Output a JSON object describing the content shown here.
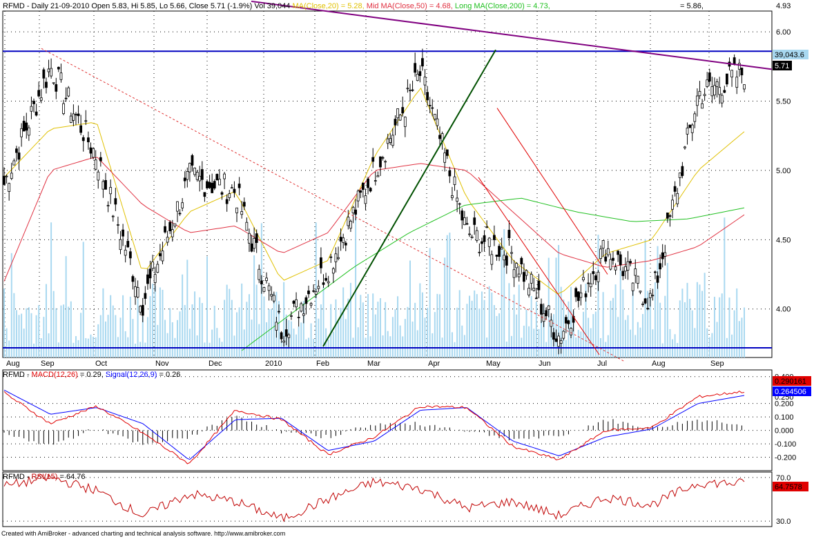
{
  "header": {
    "symbol_line": "RFMD - Daily 21-09-2010 Open 5.83, Hi 5.85, Lo 5.66, Close 5.71 (-1.9%) Vol 39,044",
    "ma20": "MA(Close,20) = 5.28,",
    "ma50": "Mid MA(Close,50) = 4.68,",
    "ma200": "Long MA(Close,200) = 4.73,",
    "extra": "= 5.86,",
    "top_right_value": "4.93"
  },
  "price_axis": {
    "ticks": [
      "6.00",
      "5.50",
      "5.00",
      "4.50",
      "4.00"
    ],
    "last_volume": "39,043.6",
    "last_close": "5.71"
  },
  "months": [
    "Aug",
    "Sep",
    "Oct",
    "Nov",
    "Dec",
    "2010",
    "Feb",
    "Mar",
    "Apr",
    "May",
    "Jun",
    "Jul",
    "Aug",
    "Sep"
  ],
  "macd": {
    "label_prefix": "RFMD - ",
    "macd_label": "MACD(12,26)",
    "macd_value": " = 0.29, ",
    "signal_label": "Signal(12,26,9)",
    "signal_value": " = 0.26",
    "ticks": [
      "0.400",
      "0.250",
      "0.200",
      "0.100",
      "0.000",
      "-0.100",
      "-0.200"
    ],
    "badge_macd": "0.290161",
    "badge_signal": "0.264506"
  },
  "rsi": {
    "label_prefix": "RFMD - ",
    "rsi_label": "RSI(15)",
    "rsi_value": " = 64.76",
    "ticks": [
      "70.0",
      "30.0"
    ],
    "badge": "64.7578"
  },
  "footer": "Created with AmiBroker - advanced charting and technical analysis software. http://www.amibroker.com",
  "footer_right": "—",
  "colors": {
    "ma20": "#e0c000",
    "ma50": "#e03040",
    "ma200": "#20c020",
    "macd": "#e00000",
    "signal": "#0000ff",
    "rsi": "#c00000",
    "trend_purple": "#800080",
    "trend_blue": "#0000c0",
    "volume": "#a8d8f0"
  },
  "chart_data": [
    {
      "type": "line",
      "title": "RFMD - Daily 21-09-2010",
      "ylim": [
        3.65,
        6.15
      ],
      "x": [
        "Aug",
        "Sep",
        "Oct",
        "Nov",
        "Dec",
        "2010",
        "Feb",
        "Mar",
        "Apr",
        "May",
        "Jun",
        "Jul",
        "Aug",
        "Sep"
      ],
      "series": [
        {
          "name": "Close",
          "values": [
            4.9,
            5.75,
            5.1,
            4.05,
            4.95,
            4.85,
            3.85,
            4.3,
            5.0,
            5.7,
            4.55,
            4.4,
            3.8,
            4.45,
            4.05,
            5.55,
            5.71
          ]
        },
        {
          "name": "MA(Close,20)",
          "values": [
            4.95,
            5.3,
            5.35,
            4.25,
            4.7,
            4.85,
            4.2,
            4.35,
            5.1,
            5.6,
            4.8,
            4.35,
            4.1,
            4.4,
            4.5,
            5.0,
            5.28
          ]
        },
        {
          "name": "Mid MA(Close,50)",
          "values": [
            4.2,
            5.0,
            5.1,
            4.75,
            4.55,
            4.6,
            4.4,
            4.55,
            5.0,
            5.05,
            5.0,
            4.7,
            4.4,
            4.3,
            4.35,
            4.45,
            4.68
          ]
        },
        {
          "name": "Long MA(Close,200)",
          "values": [
            3.7,
            4.0,
            4.3,
            4.55,
            4.75,
            4.8,
            4.7,
            4.63,
            4.65,
            4.73
          ]
        }
      ]
    },
    {
      "type": "line",
      "title": "RFMD - MACD(12,26) = 0.29, Signal(12,26,9) = 0.26",
      "ylim": [
        -0.3,
        0.45
      ],
      "series": [
        {
          "name": "MACD(12,26)",
          "values": [
            0.28,
            0.05,
            0.18,
            -0.02,
            -0.25,
            0.15,
            0.08,
            -0.18,
            -0.05,
            0.18,
            0.17,
            -0.12,
            -0.22,
            0.0,
            0.02,
            0.25,
            0.29
          ]
        },
        {
          "name": "Signal(12,26,9)",
          "values": [
            0.3,
            0.12,
            0.17,
            0.05,
            -0.22,
            0.08,
            0.09,
            -0.15,
            -0.08,
            0.15,
            0.17,
            -0.08,
            -0.19,
            -0.05,
            0.01,
            0.2,
            0.26
          ]
        }
      ]
    },
    {
      "type": "line",
      "title": "RFMD - RSI(15) = 64.76",
      "ylim": [
        25,
        75
      ],
      "series": [
        {
          "name": "RSI(15)",
          "values": [
            62,
            70,
            58,
            35,
            55,
            48,
            32,
            50,
            66,
            60,
            42,
            48,
            35,
            52,
            45,
            65,
            64.76
          ]
        }
      ]
    }
  ]
}
